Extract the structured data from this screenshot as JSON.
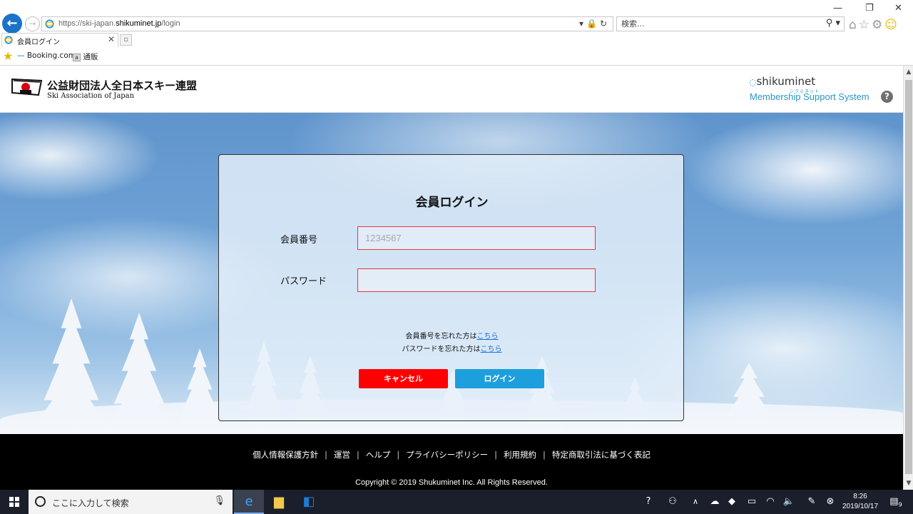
{
  "browser": {
    "url_scheme": "https://ski-japan.",
    "url_host": "shikuminet.jp",
    "url_path": "/login",
    "search_placeholder": "検索...",
    "tab_title": "会員ログイン",
    "favorites": [
      "Booking.com",
      "通販"
    ]
  },
  "header": {
    "org_name_ja": "公益財団法人全日本スキー連盟",
    "org_name_en": "Ski Association of Japan",
    "brand_name": "shikuminet",
    "brand_kana": "シクミネット",
    "system_name": "Membership Support System"
  },
  "login": {
    "title": "会員ログイン",
    "member_label": "会員番号",
    "member_placeholder": "1234567",
    "password_label": "パスワード",
    "forgot_member_text": "会員番号を忘れた方は",
    "forgot_password_text": "パスワードを忘れた方は",
    "here_link": "こちら",
    "cancel_label": "キャンセル",
    "login_label": "ログイン"
  },
  "footer": {
    "links": [
      "個人情報保護方針",
      "運営",
      "ヘルプ",
      "プライバシーポリシー",
      "利用規約",
      "特定商取引法に基づく表記"
    ],
    "copyright": "Copyright © 2019 Shukuminet Inc. All Rights Reserved."
  },
  "taskbar": {
    "search_text": "ここに入力して検索",
    "time": "8:26",
    "date": "2019/10/17",
    "notification_count": "9"
  },
  "colors": {
    "cancel_button": "#ff0000",
    "login_button": "#1e9fdd",
    "input_border": "#e53935",
    "brand_blue": "#2a95c9"
  }
}
